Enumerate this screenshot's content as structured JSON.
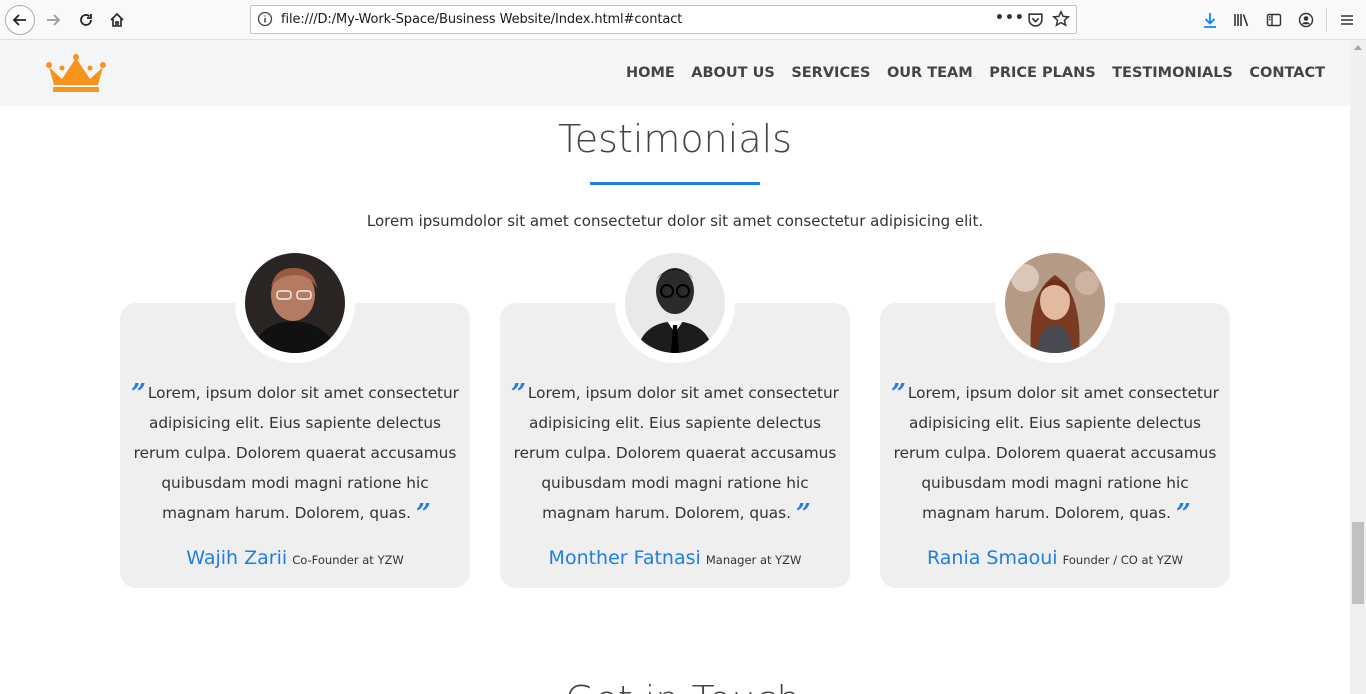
{
  "browser": {
    "url": "file:///D:/My-Work-Space/Business Website/Index.html#contact",
    "page_actions": "•••"
  },
  "site": {
    "nav": [
      "HOME",
      "ABOUT US",
      "SERVICES",
      "OUR TEAM",
      "PRICE PLANS",
      "TESTIMONIALS",
      "CONTACT"
    ],
    "accent_color": "#1f7ee0",
    "logo_color": "#f7941d"
  },
  "testimonials": {
    "title": "Testimonials",
    "subtitle": "Lorem ipsumdolor sit amet consectetur dolor sit amet consectetur adipisicing elit.",
    "cards": [
      {
        "quote": "Lorem, ipsum dolor sit amet consectetur adipisicing elit. Eius sapiente delectus rerum culpa. Dolorem quaerat accusamus quibusdam modi magni ratione hic magnam harum. Dolorem, quas.",
        "name": "Wajih Zarii",
        "role": "Co-Founder at YZW"
      },
      {
        "quote": "Lorem, ipsum dolor sit amet consectetur adipisicing elit. Eius sapiente delectus rerum culpa. Dolorem quaerat accusamus quibusdam modi magni ratione hic magnam harum. Dolorem, quas.",
        "name": "Monther Fatnasi",
        "role": "Manager at YZW"
      },
      {
        "quote": "Lorem, ipsum dolor sit amet consectetur adipisicing elit. Eius sapiente delectus rerum culpa. Dolorem quaerat accusamus quibusdam modi magni ratione hic magnam harum. Dolorem, quas.",
        "name": "Rania Smaoui",
        "role": "Founder / CO at YZW"
      }
    ]
  },
  "next_section_title": "Get in Touch",
  "quote_open": "”",
  "quote_close": "”"
}
